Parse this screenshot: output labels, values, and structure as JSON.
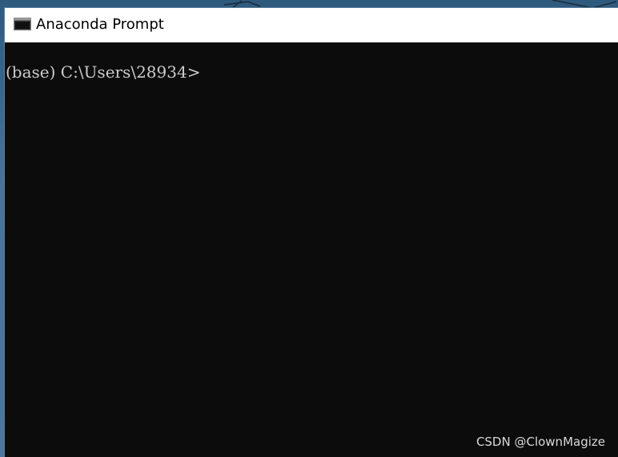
{
  "window": {
    "title": "Anaconda Prompt",
    "icon": "terminal-icon"
  },
  "console": {
    "prompt": "(base) C:\\Users\\28934>"
  },
  "watermark": {
    "text": "CSDN @ClownMagize"
  },
  "colors": {
    "console_bg": "#0c0c0c",
    "console_text": "#cccccc",
    "titlebar_bg": "#ffffff",
    "desktop": "#456d91"
  }
}
